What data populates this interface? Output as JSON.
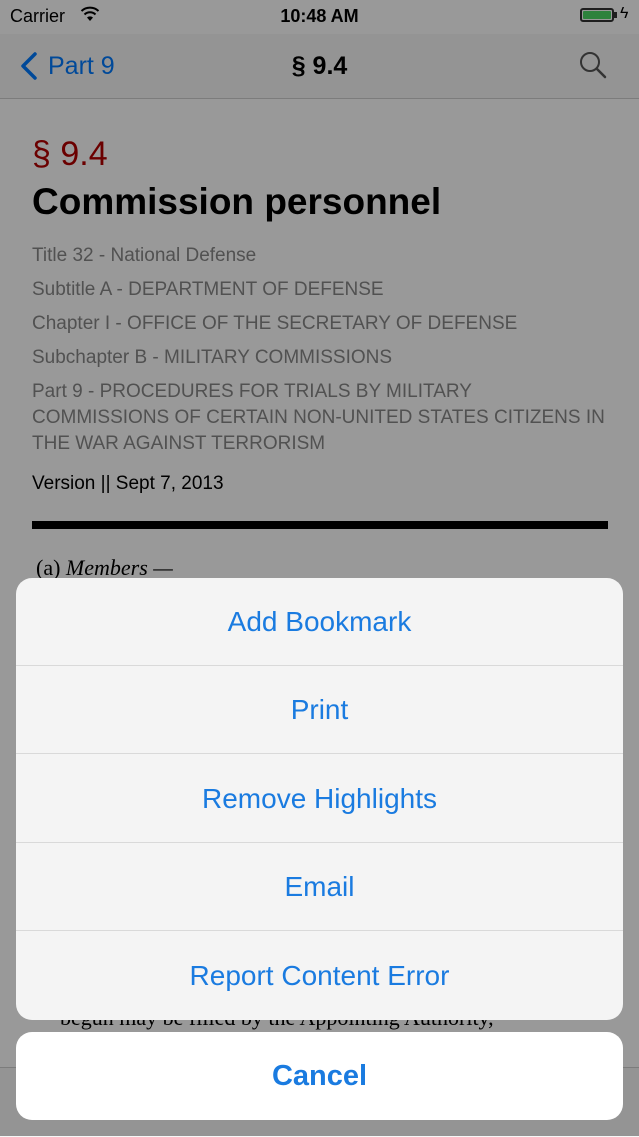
{
  "status_bar": {
    "carrier": "Carrier",
    "time": "10:48 AM"
  },
  "nav_bar": {
    "back_label": "Part 9",
    "title": "§ 9.4"
  },
  "document": {
    "section_number": "§ 9.4",
    "title": "Commission personnel",
    "hierarchy": [
      "Title 32 - National Defense",
      "Subtitle A - DEPARTMENT OF DEFENSE",
      "Chapter I - OFFICE OF THE SECRETARY OF DEFENSE",
      "Subchapter B - MILITARY COMMISSIONS",
      "Part 9 - PROCEDURES FOR TRIALS BY MILITARY COMMISSIONS OF CERTAIN NON-UNITED STATES CITIZENS IN THE WAR AGAINST TERRORISM"
    ],
    "version": "Version || Sept 7, 2013",
    "paragraph_label_prefix": "(a) ",
    "paragraph_label_title": "Members —",
    "partial_text": "begun may be filled by the Appointing Authority,"
  },
  "action_sheet": {
    "items": [
      "Add Bookmark",
      "Print",
      "Remove Highlights",
      "Email",
      "Report Content Error"
    ],
    "cancel_label": "Cancel"
  },
  "colors": {
    "accent": "#1a7be0",
    "section_red": "#b30000"
  }
}
